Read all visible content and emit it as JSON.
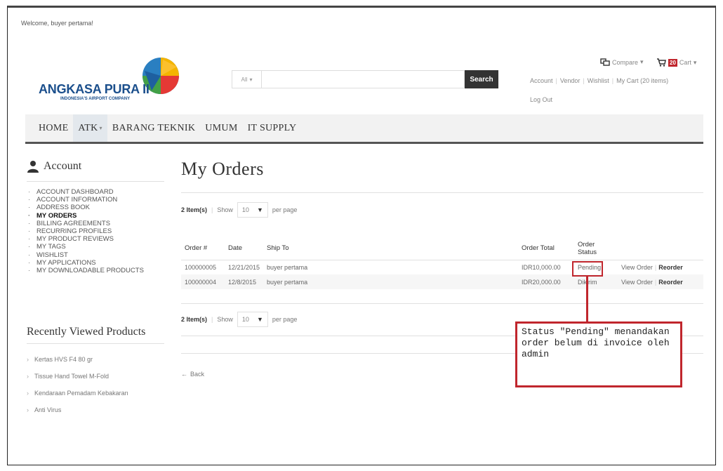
{
  "header": {
    "welcome": "Welcome, buyer pertama!",
    "logo": {
      "name": "ANGKASA PURA II",
      "tagline": "INDONESIA'S AIRPORT COMPANY"
    },
    "search": {
      "category": "All",
      "placeholder": "",
      "button": "Search"
    },
    "compare": "Compare",
    "cart": {
      "count": "20",
      "label": "Cart"
    },
    "links": [
      "Account",
      "Vendor",
      "Wishlist",
      "My Cart (20 items)"
    ],
    "logout": "Log Out"
  },
  "nav": {
    "items": [
      "HOME",
      "ATK",
      "BARANG TEKNIK",
      "UMUM",
      "IT SUPPLY"
    ]
  },
  "sidebar": {
    "title": "Account",
    "items": [
      "ACCOUNT DASHBOARD",
      "ACCOUNT INFORMATION",
      "ADDRESS BOOK",
      "MY ORDERS",
      "BILLING AGREEMENTS",
      "RECURRING PROFILES",
      "MY PRODUCT REVIEWS",
      "MY TAGS",
      "WISHLIST",
      "MY APPLICATIONS",
      "MY DOWNLOADABLE PRODUCTS"
    ],
    "recent_title": "Recently Viewed Products",
    "recent": [
      "Kertas HVS F4 80 gr",
      "Tissue Hand Towel M-Fold",
      "Kendaraan Pemadam Kebakaran",
      "Anti Virus"
    ]
  },
  "main": {
    "title": "My Orders",
    "pager": {
      "count": "2 Item(s)",
      "show": "Show",
      "per_page_value": "10",
      "per_page": "per page"
    },
    "columns": [
      "Order #",
      "Date",
      "Ship To",
      "Order Total",
      "Order Status"
    ],
    "orders": [
      {
        "number": "100000005",
        "date": "12/21/2015",
        "ship_to": "buyer pertama",
        "total": "IDR10,000.00",
        "status": "Pending",
        "view": "View Order",
        "reorder": "Reorder"
      },
      {
        "number": "100000004",
        "date": "12/8/2015",
        "ship_to": "buyer pertama",
        "total": "IDR20,000.00",
        "status": "Dikirim",
        "view": "View Order",
        "reorder": "Reorder"
      }
    ],
    "back": "Back"
  },
  "annotation": {
    "text": "Status \"Pending\" menandakan order belum di invoice oleh admin",
    "color": "#c0262d"
  }
}
